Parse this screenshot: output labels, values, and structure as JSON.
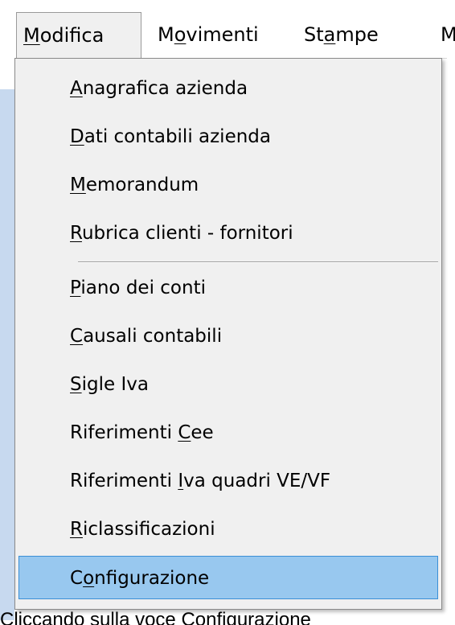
{
  "menubar": {
    "items": [
      {
        "pre": "",
        "u": "M",
        "post": "odifica"
      },
      {
        "pre": "M",
        "u": "o",
        "post": "vimenti"
      },
      {
        "pre": "St",
        "u": "a",
        "post": "mpe"
      },
      {
        "pre": "",
        "u": "",
        "post": "M"
      }
    ]
  },
  "menu": {
    "items": [
      {
        "pre": "",
        "u": "A",
        "post": "nagrafica azienda"
      },
      {
        "pre": "",
        "u": "D",
        "post": "ati contabili azienda"
      },
      {
        "pre": "",
        "u": "M",
        "post": "emorandum"
      },
      {
        "pre": "",
        "u": "R",
        "post": "ubrica clienti - fornitori"
      },
      {
        "pre": "",
        "u": "P",
        "post": "iano dei conti"
      },
      {
        "pre": "",
        "u": "C",
        "post": "ausali contabili"
      },
      {
        "pre": "",
        "u": "S",
        "post": "igle Iva"
      },
      {
        "pre": "Riferimenti ",
        "u": "C",
        "post": "ee"
      },
      {
        "pre": "Riferimenti ",
        "u": "I",
        "post": "va quadri VE/VF"
      },
      {
        "pre": "",
        "u": "R",
        "post": "iclassificazioni"
      },
      {
        "pre": "C",
        "u": "o",
        "post": "nfigurazione"
      }
    ]
  },
  "footer": {
    "text": "Cliccando sulla voce Configurazione"
  }
}
